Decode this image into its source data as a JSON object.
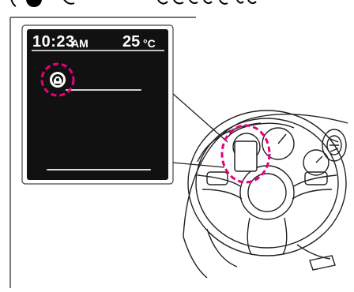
{
  "display": {
    "time": "10:23",
    "time_period": "AM",
    "temperature": "25",
    "temperature_unit": "°C"
  },
  "colors": {
    "screen": "#111111",
    "highlight": "#e5007e",
    "line": "#000000"
  },
  "icons": [
    "driver-assist-icon",
    "steering-wheel-illustration"
  ]
}
